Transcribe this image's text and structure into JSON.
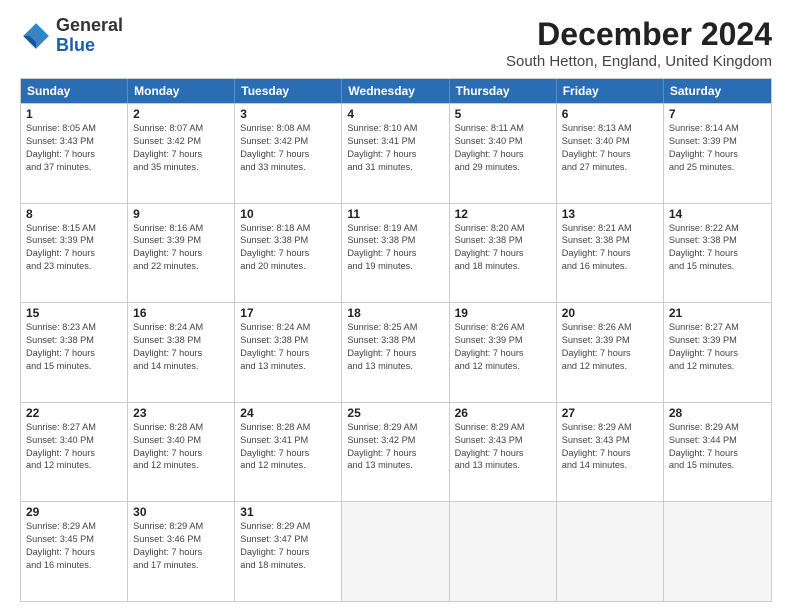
{
  "header": {
    "logo_general": "General",
    "logo_blue": "Blue",
    "main_title": "December 2024",
    "subtitle": "South Hetton, England, United Kingdom"
  },
  "calendar": {
    "days_of_week": [
      "Sunday",
      "Monday",
      "Tuesday",
      "Wednesday",
      "Thursday",
      "Friday",
      "Saturday"
    ],
    "weeks": [
      [
        {
          "day": "1",
          "info": "Sunrise: 8:05 AM\nSunset: 3:43 PM\nDaylight: 7 hours\nand 37 minutes."
        },
        {
          "day": "2",
          "info": "Sunrise: 8:07 AM\nSunset: 3:42 PM\nDaylight: 7 hours\nand 35 minutes."
        },
        {
          "day": "3",
          "info": "Sunrise: 8:08 AM\nSunset: 3:42 PM\nDaylight: 7 hours\nand 33 minutes."
        },
        {
          "day": "4",
          "info": "Sunrise: 8:10 AM\nSunset: 3:41 PM\nDaylight: 7 hours\nand 31 minutes."
        },
        {
          "day": "5",
          "info": "Sunrise: 8:11 AM\nSunset: 3:40 PM\nDaylight: 7 hours\nand 29 minutes."
        },
        {
          "day": "6",
          "info": "Sunrise: 8:13 AM\nSunset: 3:40 PM\nDaylight: 7 hours\nand 27 minutes."
        },
        {
          "day": "7",
          "info": "Sunrise: 8:14 AM\nSunset: 3:39 PM\nDaylight: 7 hours\nand 25 minutes."
        }
      ],
      [
        {
          "day": "8",
          "info": "Sunrise: 8:15 AM\nSunset: 3:39 PM\nDaylight: 7 hours\nand 23 minutes."
        },
        {
          "day": "9",
          "info": "Sunrise: 8:16 AM\nSunset: 3:39 PM\nDaylight: 7 hours\nand 22 minutes."
        },
        {
          "day": "10",
          "info": "Sunrise: 8:18 AM\nSunset: 3:38 PM\nDaylight: 7 hours\nand 20 minutes."
        },
        {
          "day": "11",
          "info": "Sunrise: 8:19 AM\nSunset: 3:38 PM\nDaylight: 7 hours\nand 19 minutes."
        },
        {
          "day": "12",
          "info": "Sunrise: 8:20 AM\nSunset: 3:38 PM\nDaylight: 7 hours\nand 18 minutes."
        },
        {
          "day": "13",
          "info": "Sunrise: 8:21 AM\nSunset: 3:38 PM\nDaylight: 7 hours\nand 16 minutes."
        },
        {
          "day": "14",
          "info": "Sunrise: 8:22 AM\nSunset: 3:38 PM\nDaylight: 7 hours\nand 15 minutes."
        }
      ],
      [
        {
          "day": "15",
          "info": "Sunrise: 8:23 AM\nSunset: 3:38 PM\nDaylight: 7 hours\nand 15 minutes."
        },
        {
          "day": "16",
          "info": "Sunrise: 8:24 AM\nSunset: 3:38 PM\nDaylight: 7 hours\nand 14 minutes."
        },
        {
          "day": "17",
          "info": "Sunrise: 8:24 AM\nSunset: 3:38 PM\nDaylight: 7 hours\nand 13 minutes."
        },
        {
          "day": "18",
          "info": "Sunrise: 8:25 AM\nSunset: 3:38 PM\nDaylight: 7 hours\nand 13 minutes."
        },
        {
          "day": "19",
          "info": "Sunrise: 8:26 AM\nSunset: 3:39 PM\nDaylight: 7 hours\nand 12 minutes."
        },
        {
          "day": "20",
          "info": "Sunrise: 8:26 AM\nSunset: 3:39 PM\nDaylight: 7 hours\nand 12 minutes."
        },
        {
          "day": "21",
          "info": "Sunrise: 8:27 AM\nSunset: 3:39 PM\nDaylight: 7 hours\nand 12 minutes."
        }
      ],
      [
        {
          "day": "22",
          "info": "Sunrise: 8:27 AM\nSunset: 3:40 PM\nDaylight: 7 hours\nand 12 minutes."
        },
        {
          "day": "23",
          "info": "Sunrise: 8:28 AM\nSunset: 3:40 PM\nDaylight: 7 hours\nand 12 minutes."
        },
        {
          "day": "24",
          "info": "Sunrise: 8:28 AM\nSunset: 3:41 PM\nDaylight: 7 hours\nand 12 minutes."
        },
        {
          "day": "25",
          "info": "Sunrise: 8:29 AM\nSunset: 3:42 PM\nDaylight: 7 hours\nand 13 minutes."
        },
        {
          "day": "26",
          "info": "Sunrise: 8:29 AM\nSunset: 3:43 PM\nDaylight: 7 hours\nand 13 minutes."
        },
        {
          "day": "27",
          "info": "Sunrise: 8:29 AM\nSunset: 3:43 PM\nDaylight: 7 hours\nand 14 minutes."
        },
        {
          "day": "28",
          "info": "Sunrise: 8:29 AM\nSunset: 3:44 PM\nDaylight: 7 hours\nand 15 minutes."
        }
      ],
      [
        {
          "day": "29",
          "info": "Sunrise: 8:29 AM\nSunset: 3:45 PM\nDaylight: 7 hours\nand 16 minutes."
        },
        {
          "day": "30",
          "info": "Sunrise: 8:29 AM\nSunset: 3:46 PM\nDaylight: 7 hours\nand 17 minutes."
        },
        {
          "day": "31",
          "info": "Sunrise: 8:29 AM\nSunset: 3:47 PM\nDaylight: 7 hours\nand 18 minutes."
        },
        {
          "day": "",
          "info": ""
        },
        {
          "day": "",
          "info": ""
        },
        {
          "day": "",
          "info": ""
        },
        {
          "day": "",
          "info": ""
        }
      ]
    ]
  }
}
